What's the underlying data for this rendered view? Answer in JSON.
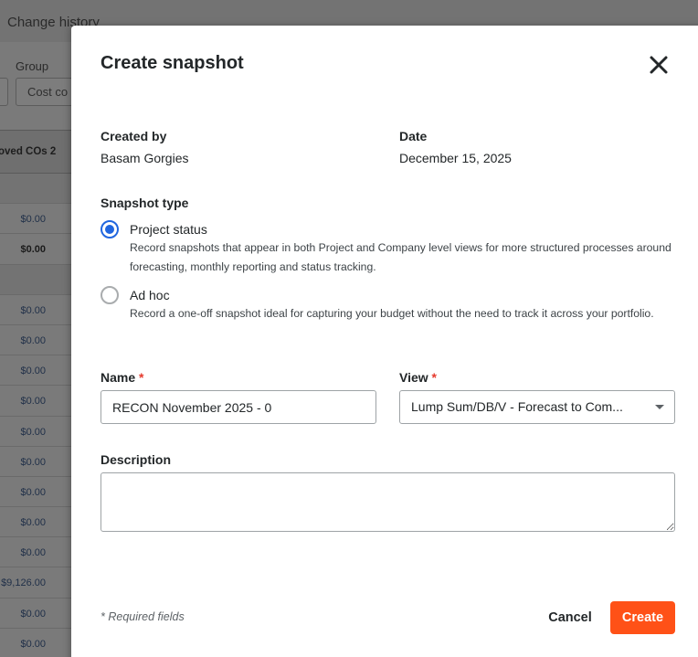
{
  "background": {
    "title": "Change history",
    "group_label": "Group",
    "group_select_value": "Cost co",
    "table_header": "oved COs 2",
    "rows": [
      {
        "value": "",
        "kind": "section"
      },
      {
        "value": "$0.00",
        "kind": "normal"
      },
      {
        "value": "$0.00",
        "kind": "bold"
      },
      {
        "value": "",
        "kind": "section"
      },
      {
        "value": "$0.00",
        "kind": "normal"
      },
      {
        "value": "$0.00",
        "kind": "normal"
      },
      {
        "value": "$0.00",
        "kind": "normal"
      },
      {
        "value": "$0.00",
        "kind": "normal"
      },
      {
        "value": "$0.00",
        "kind": "normal"
      },
      {
        "value": "$0.00",
        "kind": "normal"
      },
      {
        "value": "$0.00",
        "kind": "normal"
      },
      {
        "value": "$0.00",
        "kind": "normal"
      },
      {
        "value": "$0.00",
        "kind": "normal"
      },
      {
        "value": "$9,126.00",
        "kind": "normal"
      },
      {
        "value": "$0.00",
        "kind": "normal"
      },
      {
        "value": "$0.00",
        "kind": "normal"
      }
    ]
  },
  "modal": {
    "title": "Create snapshot",
    "close_icon": "close-icon",
    "created_by": {
      "label": "Created by",
      "value": "Basam Gorgies"
    },
    "date": {
      "label": "Date",
      "value": "December 15, 2025"
    },
    "snapshot_type": {
      "label": "Snapshot type",
      "options": [
        {
          "title": "Project status",
          "description": "Record snapshots that appear in both Project and Company level views for more structured processes around forecasting, monthly reporting and status tracking.",
          "checked": true
        },
        {
          "title": "Ad hoc",
          "description": "Record a one-off snapshot ideal for capturing your budget without the need to track it across your portfolio.",
          "checked": false
        }
      ]
    },
    "name": {
      "label": "Name",
      "required_mark": "*",
      "value": "RECON November 2025 - 0"
    },
    "view": {
      "label": "View",
      "required_mark": "*",
      "value": "Lump Sum/DB/V - Forecast to Com..."
    },
    "description": {
      "label": "Description",
      "value": ""
    },
    "required_note": "* Required fields",
    "cancel_label": "Cancel",
    "create_label": "Create",
    "colors": {
      "accent": "#ff5117",
      "radio": "#2066df",
      "required": "#e63b2e"
    }
  }
}
